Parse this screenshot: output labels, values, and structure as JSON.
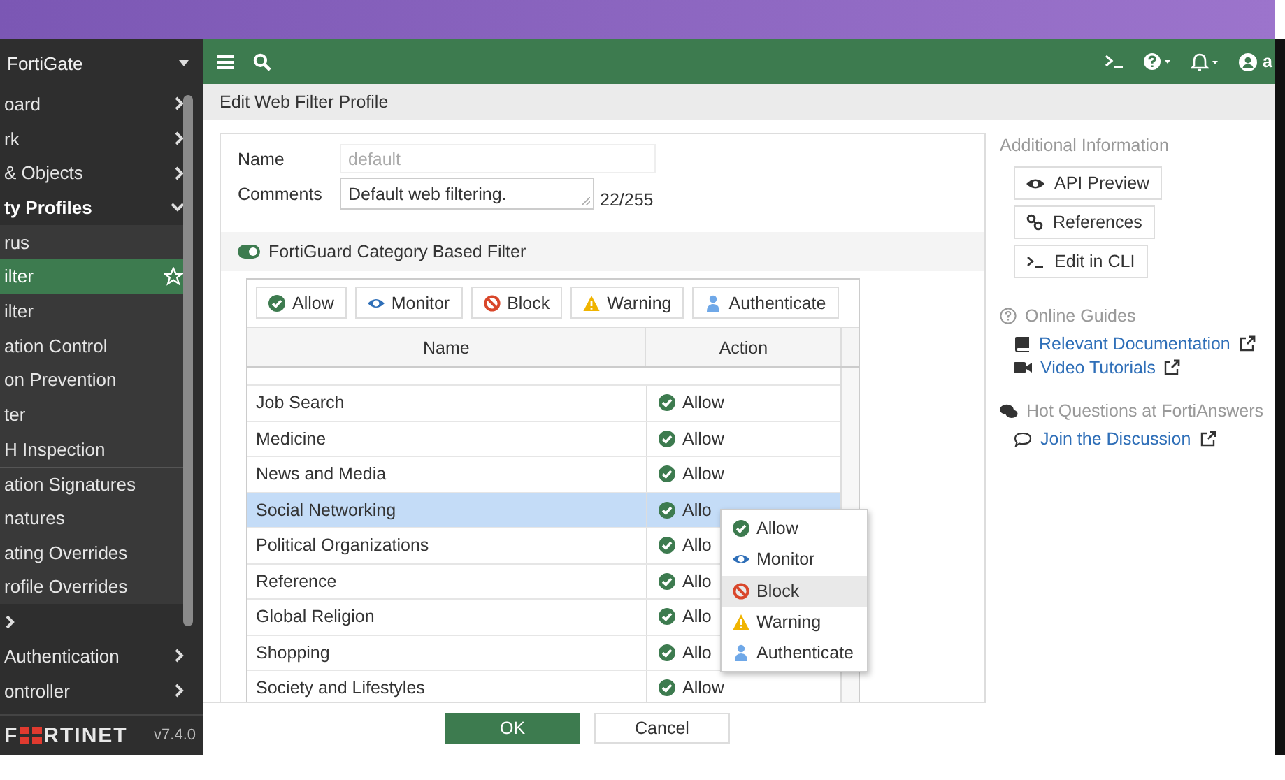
{
  "sidebar": {
    "title": "FortiGate",
    "items": [
      {
        "label": "oard",
        "selected": false,
        "expanded": false
      },
      {
        "label": "rk",
        "selected": false,
        "expanded": false
      },
      {
        "label": "& Objects",
        "selected": false,
        "expanded": false
      },
      {
        "label": "ty Profiles",
        "selected": false,
        "expanded": true,
        "children": [
          {
            "label": "rus",
            "selected": false
          },
          {
            "label": "ilter",
            "selected": true
          },
          {
            "label": "ilter",
            "selected": false
          },
          {
            "label": "ation Control",
            "selected": false
          },
          {
            "label": "on Prevention",
            "selected": false
          },
          {
            "label": "ter",
            "selected": false
          },
          {
            "label": "H Inspection",
            "selected": false
          },
          {
            "label": "ation Signatures",
            "selected": false,
            "divider_before": true
          },
          {
            "label": "natures",
            "selected": false
          },
          {
            "label": "ating Overrides",
            "selected": false
          },
          {
            "label": "rofile Overrides",
            "selected": false
          }
        ]
      },
      {
        "selected": false,
        "expanded": false
      },
      {
        "label": "Authentication",
        "selected": false,
        "expanded": false
      },
      {
        "label": "ontroller",
        "selected": false,
        "expanded": false
      }
    ],
    "logo": [
      "F",
      "RTINET"
    ],
    "version": "v7.4.0"
  },
  "top_bar": {
    "user_label": "a"
  },
  "page_title": "Edit Web Filter Profile",
  "form": {
    "name_label": "Name",
    "name_value": "default",
    "name_disabled": true,
    "comments_label": "Comments",
    "comments_value": "Default web filtering.",
    "comments_count": "22/255"
  },
  "category_filter": {
    "title": "FortiGuard Category Based Filter",
    "on": true,
    "action_buttons": [
      {
        "kind": "allow",
        "label": "Allow"
      },
      {
        "kind": "monitor",
        "label": "Monitor"
      },
      {
        "kind": "block",
        "label": "Block"
      },
      {
        "kind": "warning",
        "label": "Warning"
      },
      {
        "kind": "authenticate",
        "label": "Authenticate"
      }
    ],
    "columns": [
      "Name",
      "Action"
    ],
    "rows": [
      {
        "name": "Job Search",
        "kind": "allow",
        "action": "Allow",
        "selected": false
      },
      {
        "name": "Medicine",
        "kind": "allow",
        "action": "Allow",
        "selected": false
      },
      {
        "name": "News and Media",
        "kind": "allow",
        "action": "Allow",
        "selected": false
      },
      {
        "name": "Social Networking",
        "kind": "allow",
        "action": "Allo",
        "selected": true
      },
      {
        "name": "Political Organizations",
        "kind": "allow",
        "action": "Allo",
        "selected": false
      },
      {
        "name": "Reference",
        "kind": "allow",
        "action": "Allo",
        "selected": false
      },
      {
        "name": "Global Religion",
        "kind": "allow",
        "action": "Allo",
        "selected": false
      },
      {
        "name": "Shopping",
        "kind": "allow",
        "action": "Allo",
        "selected": false
      },
      {
        "name": "Society and Lifestyles",
        "kind": "allow",
        "action": "Allow",
        "selected": false
      }
    ],
    "menu": [
      {
        "kind": "allow",
        "label": "Allow",
        "hovered": false
      },
      {
        "kind": "monitor",
        "label": "Monitor",
        "hovered": false
      },
      {
        "kind": "block",
        "label": "Block",
        "hovered": true
      },
      {
        "kind": "warning",
        "label": "Warning",
        "hovered": false
      },
      {
        "kind": "authenticate",
        "label": "Authenticate",
        "hovered": false
      }
    ]
  },
  "info": {
    "title": "Additional Information",
    "buttons": [
      {
        "kind": "api",
        "label": "API Preview"
      },
      {
        "kind": "references",
        "label": "References"
      },
      {
        "kind": "cli",
        "label": "Edit in CLI"
      }
    ],
    "guides_title": "Online Guides",
    "guides": [
      {
        "kind": "book",
        "label": "Relevant Documentation"
      },
      {
        "kind": "video",
        "label": "Video Tutorials"
      }
    ],
    "questions_title": "Hot Questions at FortiAnswers",
    "questions": [
      {
        "kind": "comment",
        "label": "Join the Discussion"
      }
    ]
  },
  "buttons": {
    "ok": "OK",
    "cancel": "Cancel"
  }
}
